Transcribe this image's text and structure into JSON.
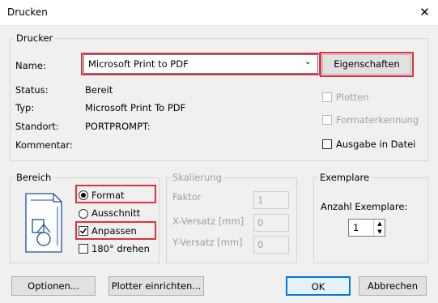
{
  "window": {
    "title": "Drucken",
    "close_icon": "close-icon"
  },
  "printer": {
    "group_label": "Drucker",
    "name_label": "Name:",
    "name_value": "Microsoft Print to PDF",
    "properties_button": "Eigenschaften",
    "status_label": "Status:",
    "status_value": "Bereit",
    "type_label": "Typ:",
    "type_value": "Microsoft Print To PDF",
    "location_label": "Standort:",
    "location_value": "PORTPROMPT:",
    "comment_label": "Kommentar:",
    "plot_label": "Plotten",
    "format_detect_label": "Formaterkennung",
    "output_to_file_label": "Ausgabe in Datei"
  },
  "range": {
    "group_label": "Bereich",
    "format_label": "Format",
    "section_label": "Ausschnitt",
    "fit_label": "Anpassen",
    "rotate_label": "180° drehen"
  },
  "scaling": {
    "group_label": "Skalierung",
    "factor_label": "Faktor",
    "factor_value": "1",
    "xoffset_label": "X-Versatz [mm]",
    "xoffset_value": "0",
    "yoffset_label": "Y-Versatz [mm]",
    "yoffset_value": "0"
  },
  "copies": {
    "group_label": "Exemplare",
    "count_label": "Anzahl Exemplare:",
    "count_value": "1"
  },
  "buttons": {
    "options": "Optionen...",
    "plotter_setup": "Plotter einrichten...",
    "ok": "OK",
    "cancel": "Abbrechen"
  },
  "colors": {
    "highlight": "#e0323c",
    "background": "#f0f0f0",
    "accent": "#0078d7"
  }
}
